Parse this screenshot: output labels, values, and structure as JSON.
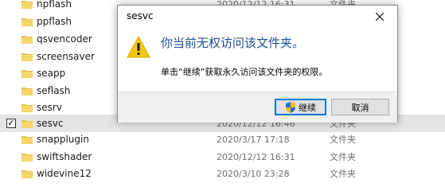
{
  "file_list": [
    {
      "name": "npflash",
      "date": "2020/12/12 16:31",
      "type": "文件夹",
      "selected": false
    },
    {
      "name": "ppflash",
      "date": "",
      "type": "",
      "selected": false
    },
    {
      "name": "qsvencoder",
      "date": "",
      "type": "",
      "selected": false
    },
    {
      "name": "screensaver",
      "date": "",
      "type": "",
      "selected": false
    },
    {
      "name": "seapp",
      "date": "",
      "type": "",
      "selected": false
    },
    {
      "name": "seflash",
      "date": "",
      "type": "",
      "selected": false
    },
    {
      "name": "sesrv",
      "date": "",
      "type": "",
      "selected": false
    },
    {
      "name": "sesvc",
      "date": "2020/12/12 16:46",
      "type": "文件夹",
      "selected": true
    },
    {
      "name": "snapplugin",
      "date": "2020/3/17 17:18",
      "type": "文件夹",
      "selected": false
    },
    {
      "name": "swiftshader",
      "date": "2020/12/12 16:31",
      "type": "文件夹",
      "selected": false
    },
    {
      "name": "widevine12",
      "date": "2020/3/10 23:28",
      "type": "文件夹",
      "selected": false
    }
  ],
  "dialog": {
    "title": "sesvc",
    "main_instruction": "你当前无权访问该文件夹。",
    "content": "单击“继续”获取永久访问该文件夹的权限。",
    "continue_label": "继续",
    "cancel_label": "取消",
    "icon": "warning-icon"
  },
  "colors": {
    "instruction": "#1f4e96",
    "folder": "#e8c04a",
    "warning": "#f5c60c",
    "selected_row": "#e5e5e5"
  }
}
